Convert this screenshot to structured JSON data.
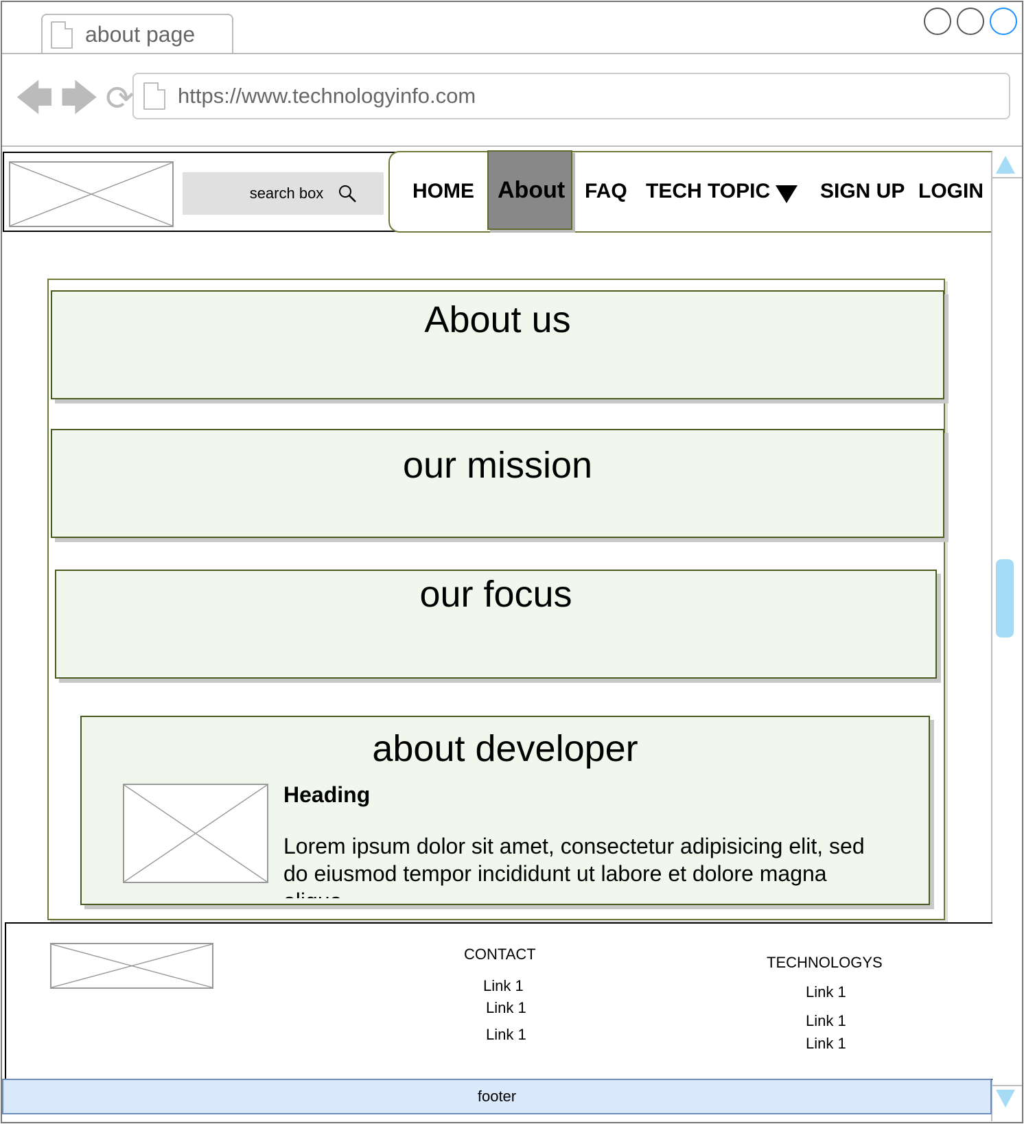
{
  "browser": {
    "tab_title": "about page",
    "url": "https://www.technologyinfo.com"
  },
  "header": {
    "search_placeholder": "search box",
    "nav": {
      "home": "HOME",
      "about": "About",
      "faq": "FAQ",
      "tech_topic": "TECH TOPIC",
      "sign_up": "SIGN UP",
      "login": "LOGIN"
    },
    "active_nav": "About"
  },
  "sections": {
    "about_us": "About us",
    "mission": "our mission",
    "focus": "our focus",
    "developer": {
      "title": "about developer",
      "heading": "Heading",
      "body": "Lorem ipsum dolor sit amet, consectetur adipisicing elit, sed do eiusmod tempor incididunt ut labore et dolore magna aliqua."
    }
  },
  "footer": {
    "contact": {
      "title": "CONTACT",
      "links": [
        "Link 1",
        "Link 1",
        "Link 1"
      ]
    },
    "technologies": {
      "title": "TECHNOLOGYS",
      "links": [
        "Link 1",
        "Link 1",
        "Link 1"
      ]
    },
    "bar_label": "footer"
  },
  "colors": {
    "panel_fill": "#f1f7ec",
    "panel_border": "#4a5a1f",
    "active_nav_bg": "#888888",
    "scroll_accent": "#a6dbf5",
    "footer_bar": "#dae8fc"
  },
  "icons": [
    "back-arrow-icon",
    "forward-arrow-icon",
    "reload-icon",
    "page-icon",
    "search-icon",
    "dropdown-triangle-icon"
  ]
}
